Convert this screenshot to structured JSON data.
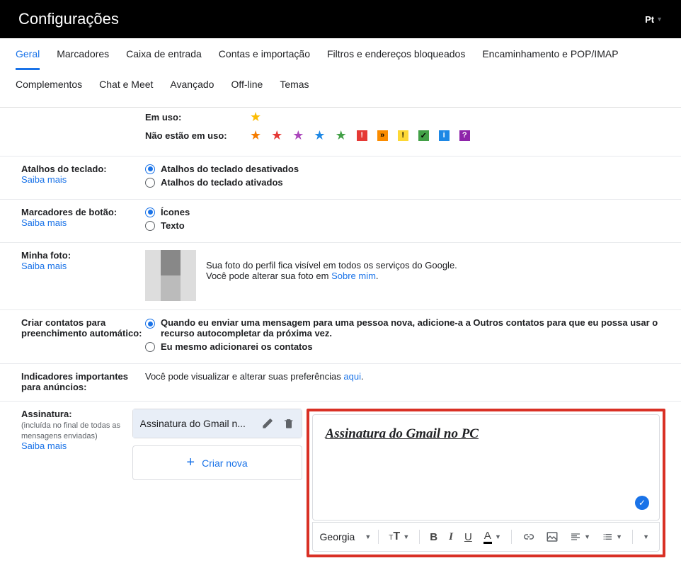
{
  "header": {
    "title": "Configurações",
    "lang": "Pt"
  },
  "tabs1": [
    "Geral",
    "Marcadores",
    "Caixa de entrada",
    "Contas e importação",
    "Filtros e endereços bloqueados",
    "Encaminhamento e POP/IMAP"
  ],
  "tabs2": [
    "Complementos",
    "Chat e Meet",
    "Avançado",
    "Off-line",
    "Temas"
  ],
  "active_tab": "Geral",
  "stars": {
    "in_use_label": "Em uso:",
    "not_in_use_label": "Não estão em uso:"
  },
  "keyboard": {
    "label": "Atalhos do teclado:",
    "learn_more": "Saiba mais",
    "opt_off": "Atalhos do teclado desativados",
    "opt_on": "Atalhos do teclado ativados"
  },
  "button_markers": {
    "label": "Marcadores de botão:",
    "learn_more": "Saiba mais",
    "opt_icons": "Ícones",
    "opt_text": "Texto"
  },
  "photo": {
    "label": "Minha foto:",
    "learn_more": "Saiba mais",
    "desc1": "Sua foto do perfil fica visível em todos os serviços do Google.",
    "desc2a": "Você pode alterar sua foto em ",
    "desc2b": "Sobre mim",
    "desc2c": "."
  },
  "contacts": {
    "label": "Criar contatos para preenchimento automático:",
    "opt_auto": "Quando eu enviar uma mensagem para uma pessoa nova, adicione-a a Outros contatos para que eu possa usar o recurso autocompletar da próxima vez.",
    "opt_manual": "Eu mesmo adicionarei os contatos"
  },
  "ads": {
    "label": "Indicadores importantes para anúncios:",
    "desc_a": "Você pode visualizar e alterar suas preferências ",
    "desc_b": "aqui",
    "desc_c": "."
  },
  "signature": {
    "label": "Assinatura:",
    "sub": "(incluída no final de todas as mensagens enviadas)",
    "learn_more": "Saiba mais",
    "item_name": "Assinatura do Gmail n...",
    "editor_text": "Assinatura do Gmail no PC",
    "font": "Georgia",
    "create_new": "Criar nova"
  }
}
